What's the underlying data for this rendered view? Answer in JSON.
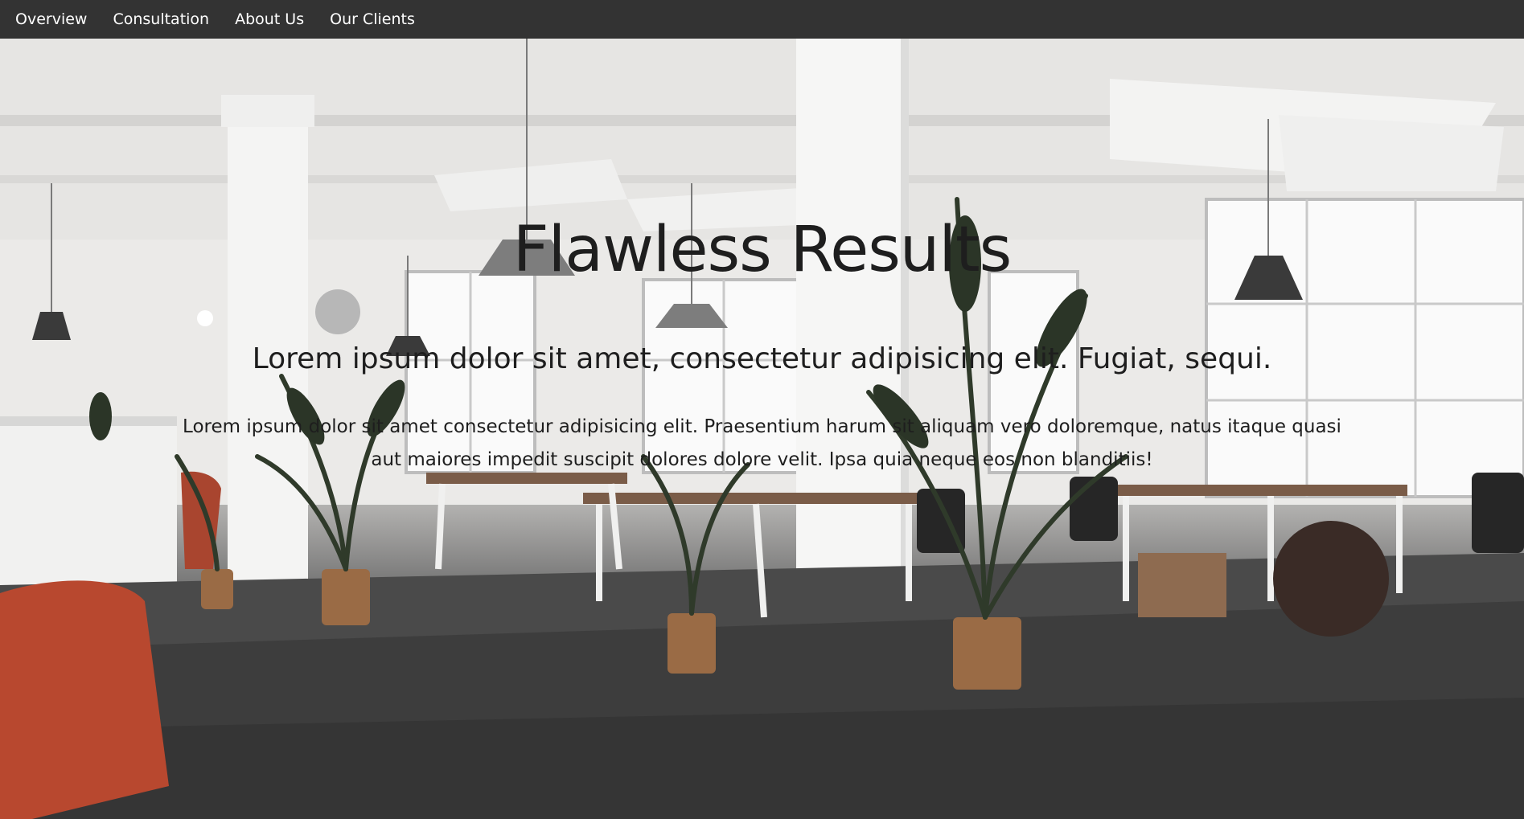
{
  "nav": {
    "items": [
      {
        "label": "Overview"
      },
      {
        "label": "Consultation"
      },
      {
        "label": "About Us"
      },
      {
        "label": "Our Clients"
      }
    ]
  },
  "hero": {
    "title": "Flawless Results",
    "subtitle": "Lorem ipsum dolor sit amet, consectetur adipisicing elit. Fugiat, sequi.",
    "body": "Lorem ipsum dolor sit amet consectetur adipisicing elit. Praesentium harum sit aliquam vero doloremque, natus itaque quasi aut maiores impedit suscipit dolores dolore velit. Ipsa quia neque eos non blanditiis!"
  },
  "colors": {
    "nav_background": "#333333",
    "nav_text": "#ffffff",
    "hero_text": "#1e1e1e"
  }
}
